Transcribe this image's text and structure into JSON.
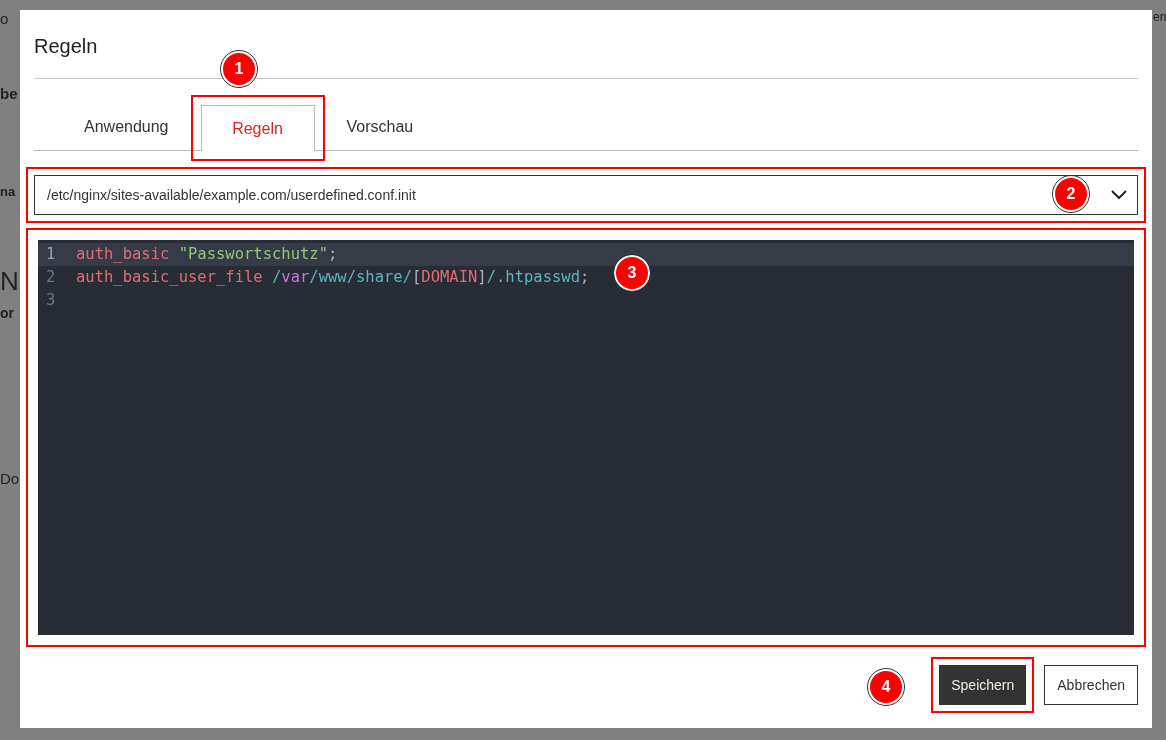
{
  "backdrop": {
    "fragments": [
      "o",
      "be",
      "na",
      "N",
      "or",
      "Do",
      "en"
    ]
  },
  "dialog": {
    "title": "Regeln",
    "tabs": [
      {
        "label": "Anwendung",
        "selected": false
      },
      {
        "label": "Regeln",
        "selected": true
      },
      {
        "label": "Vorschau",
        "selected": false
      }
    ],
    "file_select": {
      "value": "/etc/nginx/sites-available/example.com/userdefined.conf.init"
    },
    "editor": {
      "lines": [
        {
          "number": "1",
          "active": true,
          "tokens": [
            {
              "kind": "keyword",
              "text": "auth_basic"
            },
            {
              "kind": "string",
              "text": " \"Passwortschutz\""
            },
            {
              "kind": "plain",
              "text": ";"
            }
          ]
        },
        {
          "number": "2",
          "active": false,
          "tokens": [
            {
              "kind": "keyword",
              "text": "auth_basic_user_file"
            },
            {
              "kind": "path",
              "text": " /"
            },
            {
              "kind": "var",
              "text": "var"
            },
            {
              "kind": "path",
              "text": "/www/share/"
            },
            {
              "kind": "plain",
              "text": "["
            },
            {
              "kind": "keyword",
              "text": "DOMAIN"
            },
            {
              "kind": "plain",
              "text": "]"
            },
            {
              "kind": "path",
              "text": "/.htpasswd"
            },
            {
              "kind": "plain",
              "text": ";"
            }
          ]
        },
        {
          "number": "3",
          "active": false
        }
      ]
    },
    "buttons": [
      {
        "label": "Speichern",
        "kind": "primary"
      },
      {
        "label": "Abbrechen",
        "kind": "secondary"
      }
    ]
  },
  "annotations": [
    {
      "label": "1"
    },
    {
      "label": "2"
    },
    {
      "label": "3"
    },
    {
      "label": "4"
    }
  ]
}
